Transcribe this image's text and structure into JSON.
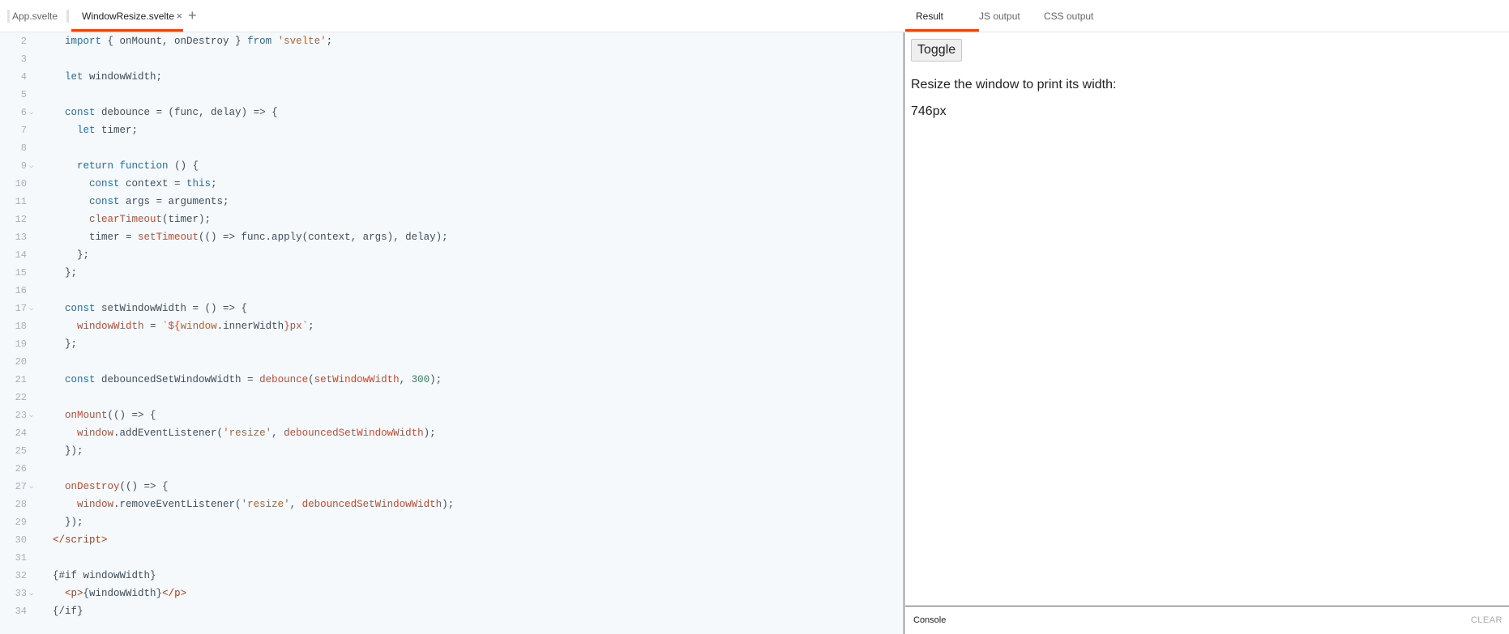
{
  "editor": {
    "tabs": [
      {
        "label": "App.svelte"
      },
      {
        "label": "WindowResize.svelte"
      }
    ],
    "close_glyph": "×",
    "add_glyph": "+",
    "lines": [
      {
        "num": "2",
        "fold": false,
        "html": "  <span class=\"k\">import</span> { onMount, onDestroy } <span class=\"k\">from</span> <span class=\"s\">'svelte'</span>;"
      },
      {
        "num": "3",
        "fold": false,
        "html": ""
      },
      {
        "num": "4",
        "fold": false,
        "html": "  <span class=\"k\">let</span> windowWidth;"
      },
      {
        "num": "5",
        "fold": false,
        "html": ""
      },
      {
        "num": "6",
        "fold": true,
        "html": "  <span class=\"k\">const</span> debounce = (func, delay) => {"
      },
      {
        "num": "7",
        "fold": false,
        "html": "    <span class=\"k\">let</span> timer;"
      },
      {
        "num": "8",
        "fold": false,
        "html": ""
      },
      {
        "num": "9",
        "fold": true,
        "html": "    <span class=\"k\">return</span> <span class=\"k\">function</span> () {"
      },
      {
        "num": "10",
        "fold": false,
        "html": "      <span class=\"k\">const</span> context = <span class=\"k\">this</span>;"
      },
      {
        "num": "11",
        "fold": false,
        "html": "      <span class=\"k\">const</span> args = arguments;"
      },
      {
        "num": "12",
        "fold": false,
        "html": "      <span class=\"f\">clearTimeout</span>(timer);"
      },
      {
        "num": "13",
        "fold": false,
        "html": "      timer = <span class=\"f\">setTimeout</span>(() => func.apply(context, args), delay);"
      },
      {
        "num": "14",
        "fold": false,
        "html": "    };"
      },
      {
        "num": "15",
        "fold": false,
        "html": "  };"
      },
      {
        "num": "16",
        "fold": false,
        "html": ""
      },
      {
        "num": "17",
        "fold": true,
        "html": "  <span class=\"k\">const</span> setWindowWidth = () => {"
      },
      {
        "num": "18",
        "fold": false,
        "html": "    <span class=\"f\">windowWidth</span> = <span class=\"f\">`${</span><span class=\"s\">window</span>.innerWidth<span class=\"f\">}px`</span>;"
      },
      {
        "num": "19",
        "fold": false,
        "html": "  };"
      },
      {
        "num": "20",
        "fold": false,
        "html": ""
      },
      {
        "num": "21",
        "fold": false,
        "html": "  <span class=\"k\">const</span> debouncedSetWindowWidth = <span class=\"f\">debounce</span>(<span class=\"f\">setWindowWidth</span>, <span class=\"n\">300</span>);"
      },
      {
        "num": "22",
        "fold": false,
        "html": ""
      },
      {
        "num": "23",
        "fold": true,
        "html": "  <span class=\"f\">onMount</span>(() => {"
      },
      {
        "num": "24",
        "fold": false,
        "html": "    <span class=\"f\">window</span>.addEventListener(<span class=\"s\">'resize'</span>, <span class=\"f\">debouncedSetWindowWidth</span>);"
      },
      {
        "num": "25",
        "fold": false,
        "html": "  });"
      },
      {
        "num": "26",
        "fold": false,
        "html": ""
      },
      {
        "num": "27",
        "fold": true,
        "html": "  <span class=\"f\">onDestroy</span>(() => {"
      },
      {
        "num": "28",
        "fold": false,
        "html": "    <span class=\"f\">window</span>.removeEventListener(<span class=\"s\">'resize'</span>, <span class=\"f\">debouncedSetWindowWidth</span>);"
      },
      {
        "num": "29",
        "fold": false,
        "html": "  });"
      },
      {
        "num": "30",
        "fold": false,
        "html": "<span class=\"t\">&lt;/script&gt;</span>"
      },
      {
        "num": "31",
        "fold": false,
        "html": ""
      },
      {
        "num": "32",
        "fold": false,
        "html": "{#if windowWidth}"
      },
      {
        "num": "33",
        "fold": true,
        "html": "  <span class=\"t\">&lt;p&gt;</span>{windowWidth}<span class=\"t\">&lt;/p&gt;</span>"
      },
      {
        "num": "34",
        "fold": false,
        "html": "{/if}"
      }
    ]
  },
  "result": {
    "tabs": [
      {
        "label": "Result"
      },
      {
        "label": "JS output"
      },
      {
        "label": "CSS output"
      }
    ],
    "toggle_label": "Toggle",
    "resize_text": "Resize the window to print its width:",
    "width_text": "746px",
    "console_label": "Console",
    "clear_label": "CLEAR"
  },
  "colors": {
    "accent": "#ff3e00",
    "editor_bg": "#f5f9fc",
    "keyword": "#1e6fa8",
    "string": "#b0632b",
    "function": "#c9482b",
    "number": "#2e8b57"
  }
}
